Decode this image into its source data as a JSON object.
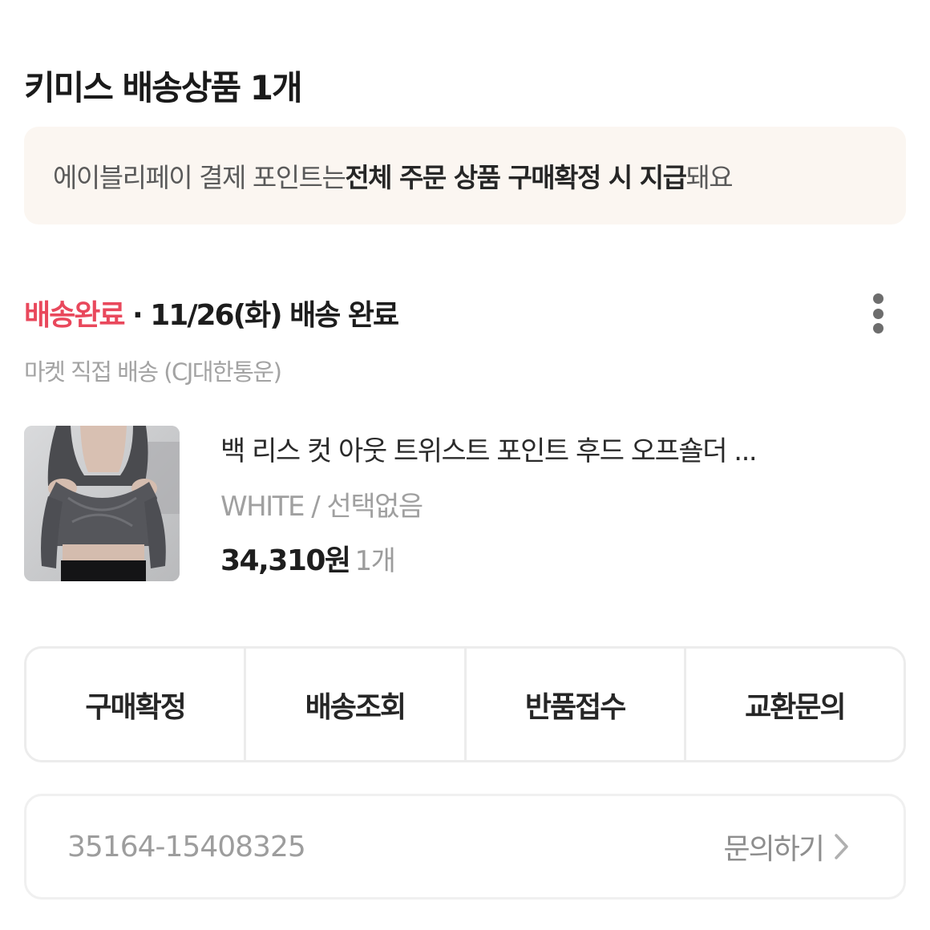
{
  "section": {
    "title": "키미스 배송상품 1개"
  },
  "notice": {
    "prefix": "에이블리페이 결제 포인트는 ",
    "highlight": "전체 주문 상품 구매확정 시 지급",
    "suffix": "돼요"
  },
  "shipment": {
    "status": "배송완료",
    "separator": " · ",
    "detail": "11/26(화) 배송 완료",
    "carrier": "마켓 직접 배송 (CJ대한통운)",
    "more_icon": "more-vertical-icon"
  },
  "product": {
    "name": "백 리스 컷 아웃 트위스트 포인트 후드 오프숄더 ...",
    "option": "WHITE / 선택없음",
    "price": "34,310원",
    "quantity": "1개",
    "thumbnail_icon": "product-photo"
  },
  "actions": [
    {
      "label": "구매확정"
    },
    {
      "label": "배송조회"
    },
    {
      "label": "반품접수"
    },
    {
      "label": "교환문의"
    }
  ],
  "inquiry": {
    "order_number": "35164-15408325",
    "link_label": "문의하기",
    "chevron_icon": "chevron-right-icon"
  },
  "colors": {
    "status_red": "#e9485c",
    "notice_bg": "#fbf6f1",
    "border": "#ececec"
  }
}
